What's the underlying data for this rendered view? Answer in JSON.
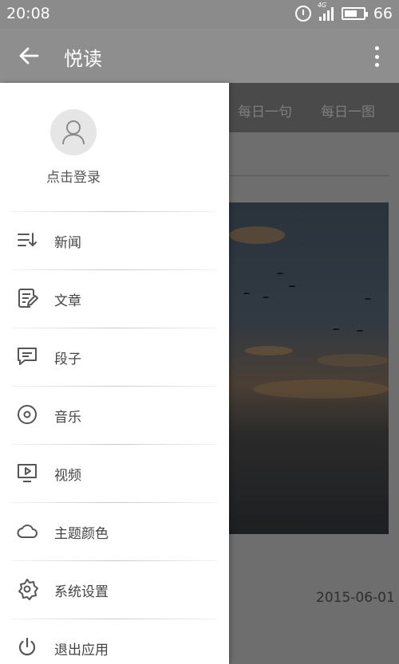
{
  "status_bar": {
    "time": "20:08",
    "network": "4G",
    "battery": "66"
  },
  "app_bar": {
    "title": "悦读"
  },
  "tabs": [
    "每日一句",
    "每日一图"
  ],
  "content": {
    "date": "2015-06-01"
  },
  "drawer": {
    "login_label": "点击登录",
    "items": [
      {
        "label": "新闻",
        "icon": "news-list-icon"
      },
      {
        "label": "文章",
        "icon": "article-edit-icon"
      },
      {
        "label": "段子",
        "icon": "message-icon"
      },
      {
        "label": "音乐",
        "icon": "music-disc-icon"
      },
      {
        "label": "视频",
        "icon": "video-play-icon"
      },
      {
        "label": "主题颜色",
        "icon": "cloud-icon"
      },
      {
        "label": "系统设置",
        "icon": "settings-gear-icon"
      },
      {
        "label": "退出应用",
        "icon": "power-icon"
      }
    ]
  },
  "colors": {
    "status_bar": "#8b8b8b",
    "app_bar": "#8e8e8e",
    "drawer_bg": "#ffffff",
    "scrim": "#6e6e6e"
  }
}
